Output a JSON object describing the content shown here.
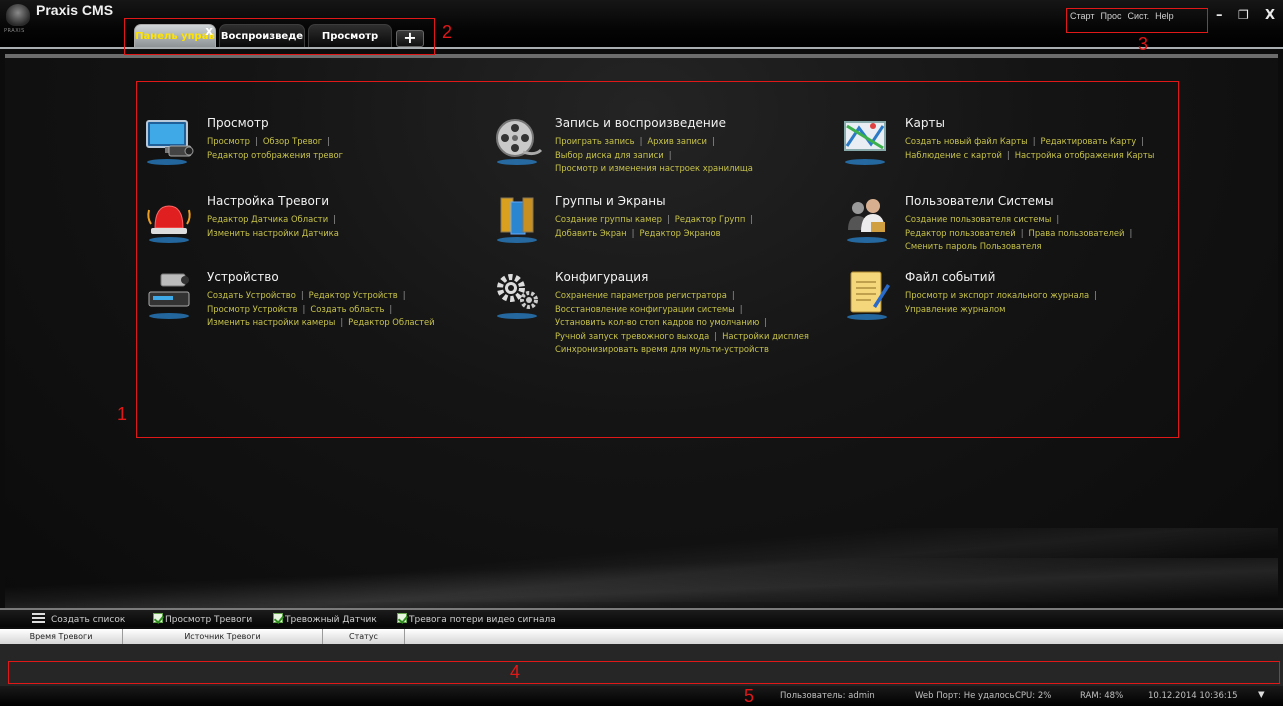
{
  "app": {
    "title": "Praxis CMS",
    "logo_caption": "PRAXIS"
  },
  "tabs": [
    {
      "label": "Панель управ",
      "active": true
    },
    {
      "label": "Воспроизведе",
      "active": false
    },
    {
      "label": "Просмотр",
      "active": false
    }
  ],
  "tab_add_label": "+",
  "tab_close_label": "x",
  "top_menu": [
    "Старт",
    "Прос",
    "Сист.",
    "Help"
  ],
  "window_controls": {
    "minimize": "–",
    "restore": "❐",
    "close": "X"
  },
  "annotations": [
    "1",
    "2",
    "3",
    "4",
    "5"
  ],
  "sections": {
    "view": {
      "title": "Просмотр",
      "icon": "monitor-camera-icon",
      "rows": [
        [
          "Просмотр",
          "Обзор Тревог"
        ],
        [
          "Редактор отображения тревог"
        ]
      ]
    },
    "record": {
      "title": "Запись и воспроизведение",
      "icon": "film-reel-icon",
      "rows": [
        [
          "Проиграть запись",
          "Архив записи"
        ],
        [
          "Выбор диска для записи"
        ],
        [
          "Просмотр и изменения настроек хранилища"
        ]
      ]
    },
    "maps": {
      "title": "Карты",
      "icon": "map-icon",
      "rows": [
        [
          "Создать новый файл Карты",
          "Редактировать Карту"
        ],
        [
          "Наблюдение с картой",
          "Настройка отображения Карты"
        ]
      ]
    },
    "alarm": {
      "title": "Настройка Тревоги",
      "icon": "alarm-siren-icon",
      "rows": [
        [
          "Редактор Датчика Области"
        ],
        [
          "Изменить настройки Датчика"
        ]
      ]
    },
    "groups": {
      "title": "Группы и Экраны",
      "icon": "screens-group-icon",
      "rows": [
        [
          "Создание группы камер",
          "Редактор Групп"
        ],
        [
          "Добавить Экран",
          "Редактор Экранов"
        ]
      ]
    },
    "users": {
      "title": "Пользователи Системы",
      "icon": "users-icon",
      "rows": [
        [
          "Создание пользователя системы"
        ],
        [
          "Редактор пользователей",
          "Права пользователей"
        ],
        [
          "Сменить пароль Пользователя"
        ]
      ]
    },
    "device": {
      "title": "Устройство",
      "icon": "device-camera-icon",
      "rows": [
        [
          "Создать Устройство",
          "Редактор Устройств"
        ],
        [
          "Просмотр Устройств",
          "Создать область"
        ],
        [
          "Изменить настройки камеры",
          "Редактор Областей"
        ]
      ]
    },
    "config": {
      "title": "Конфигурация",
      "icon": "gears-icon",
      "rows": [
        [
          "Сохранение параметров регистратора"
        ],
        [
          "Восстановление конфигурации системы"
        ],
        [
          "Установить кол-во стоп кадров по умолчанию"
        ],
        [
          "Ручной запуск тревожного выхода",
          "Настройки дисплея"
        ],
        [
          "Синхронизировать время для мульти-устройств"
        ]
      ]
    },
    "log": {
      "title": "Файл событий",
      "icon": "notepad-icon",
      "rows": [
        [
          "Просмотр и экспорт локального журнала"
        ],
        [
          "Управление журналом"
        ]
      ]
    }
  },
  "alarm_bar": {
    "create_list": "Создать список",
    "checkboxes": [
      {
        "label": "Просмотр Тревоги",
        "checked": true
      },
      {
        "label": "Тревожный Датчик",
        "checked": true
      },
      {
        "label": "Тревога потери видео сигнала",
        "checked": true
      }
    ]
  },
  "columns": [
    "Время Тревоги",
    "Источник Тревоги",
    "Статус"
  ],
  "status": {
    "user": "Пользователь: admin",
    "web_port": "Web Порт: Не удалось",
    "cpu": "CPU: 2%",
    "ram": "RAM: 48%",
    "datetime": "10.12.2014 10:36:15",
    "menu_arrow": "▼"
  },
  "colors": {
    "link": "#c7c34a",
    "annotation": "#e01818",
    "active_tab_text": "#ffe400"
  }
}
